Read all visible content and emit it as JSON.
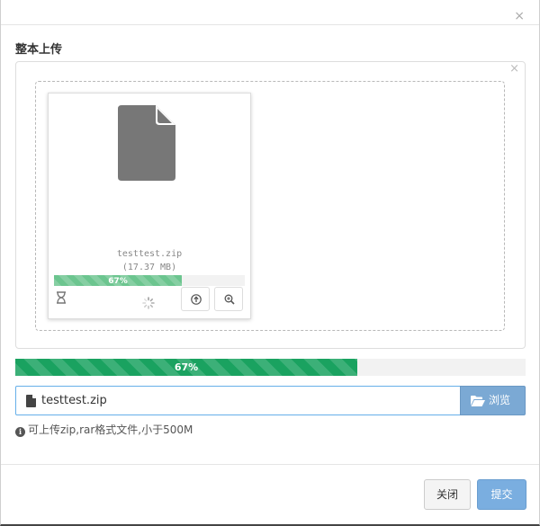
{
  "dialog": {
    "close_icon": "×",
    "section_title": "整本上传"
  },
  "upload_box": {
    "close_icon": "×"
  },
  "file_card": {
    "file_name": "testtest.zip",
    "file_size": "(17.37 MB)",
    "progress_percent": 67,
    "progress_label": "67%",
    "icons": [
      "file-icon",
      "hourglass-icon",
      "spinner-icon",
      "upload-icon",
      "zoom-in-icon"
    ]
  },
  "main_progress": {
    "percent": 67,
    "label": "67%"
  },
  "file_input": {
    "value": "testtest.zip",
    "icon": "file-icon"
  },
  "browse_button": {
    "label": "浏览",
    "icon": "folder-open-icon"
  },
  "hint": {
    "icon": "i",
    "text": "可上传zip,rar格式文件,小于500M"
  },
  "footer": {
    "close_label": "关闭",
    "submit_label": "提交"
  },
  "colors": {
    "progress_green": "#1aa260",
    "card_progress_green": "#6cc58f",
    "primary_blue": "#7ba9d4",
    "focus_border": "#66afe9"
  }
}
